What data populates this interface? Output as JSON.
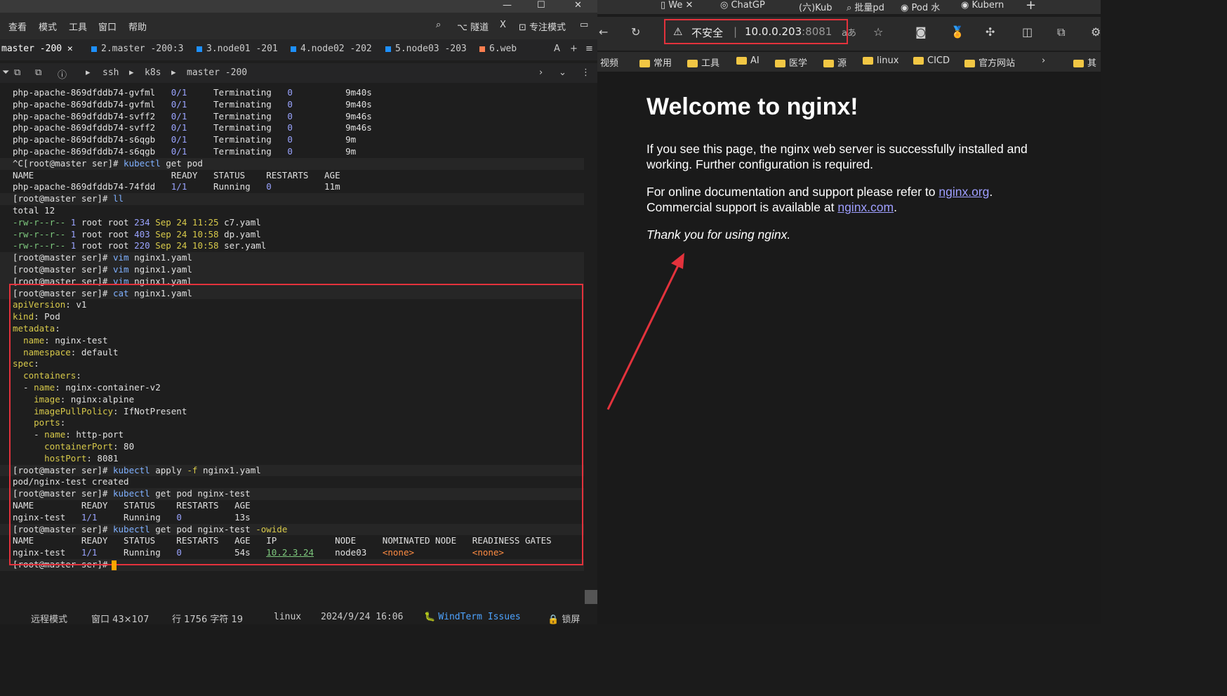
{
  "window": {
    "min": "—",
    "max": "☐",
    "close": "✕"
  },
  "menu": [
    "查看",
    "模式",
    "工具",
    "窗口",
    "帮助"
  ],
  "menu_right": {
    "search": "⌕",
    "tunnel": "隧道",
    "x": "X",
    "focus": "专注模式",
    "layout": "▭"
  },
  "tabs": [
    {
      "label": "master -200"
    },
    {
      "label": "2.master -200:3"
    },
    {
      "label": "3.node01 -201"
    },
    {
      "label": "4.node02 -202"
    },
    {
      "label": "5.node03 -203"
    },
    {
      "label": "6.web"
    }
  ],
  "tab_tools": [
    "A",
    "+",
    "≡"
  ],
  "crumb": [
    "ssh",
    "k8s",
    "master -200"
  ],
  "terminal": [
    [
      "php-apache-869dfddb74-gvfml   0/1     Terminating   0          9m40s"
    ],
    [
      "php-apache-869dfddb74-gvfml   0/1     Terminating   0          9m40s"
    ],
    [
      "php-apache-869dfddb74-svff2   0/1     Terminating   0          9m46s"
    ],
    [
      "php-apache-869dfddb74-svff2   0/1     Terminating   0          9m46s"
    ],
    [
      "php-apache-869dfddb74-s6qgb   0/1     Terminating   0          9m"
    ],
    [
      "php-apache-869dfddb74-s6qgb   0/1     Terminating   0          9m"
    ],
    [
      "^C[root@master ser]# kubectl get pod"
    ],
    [
      "NAME                          READY   STATUS    RESTARTS   AGE"
    ],
    [
      "php-apache-869dfddb74-74fdd   1/1     Running   0          11m"
    ],
    [
      "[root@master ser]# ll"
    ],
    [
      "total 12"
    ],
    [
      "-rw-r--r-- 1 root root 234 Sep 24 11:25 c7.yaml"
    ],
    [
      "-rw-r--r-- 1 root root 403 Sep 24 10:58 dp.yaml"
    ],
    [
      "-rw-r--r-- 1 root root 220 Sep 24 10:58 ser.yaml"
    ],
    [
      "[root@master ser]# vim nginx1.yaml"
    ],
    [
      "[root@master ser]# vim nginx1.yaml"
    ],
    [
      "[root@master ser]# vim nginx1.yaml"
    ],
    [
      "[root@master ser]# cat nginx1.yaml"
    ],
    [
      "apiVersion: v1"
    ],
    [
      "kind: Pod"
    ],
    [
      "metadata:"
    ],
    [
      "  name: nginx-test"
    ],
    [
      "  namespace: default"
    ],
    [
      "spec:"
    ],
    [
      "  containers:"
    ],
    [
      "  - name: nginx-container-v2"
    ],
    [
      "    image: nginx:alpine"
    ],
    [
      "    imagePullPolicy: IfNotPresent"
    ],
    [
      "    ports:"
    ],
    [
      "    - name: http-port"
    ],
    [
      "      containerPort: 80"
    ],
    [
      "      hostPort: 8081"
    ],
    [
      "[root@master ser]# kubectl apply -f nginx1.yaml"
    ],
    [
      "pod/nginx-test created"
    ],
    [
      "[root@master ser]# kubectl get pod nginx-test"
    ],
    [
      "NAME         READY   STATUS    RESTARTS   AGE"
    ],
    [
      "nginx-test   1/1     Running   0          13s"
    ],
    [
      "[root@master ser]# kubectl get pod nginx-test -owide"
    ],
    [
      "NAME         READY   STATUS    RESTARTS   AGE   IP           NODE     NOMINATED NODE   READINESS GATES"
    ],
    [
      "nginx-test   1/1     Running   0          54s   10.2.3.24    node03   <none>           <none>"
    ],
    [
      "[root@master ser]# "
    ]
  ],
  "status": {
    "mode": "远程模式",
    "window": "窗口 43×107",
    "pos": "行 1756 字符 19",
    "os": "linux",
    "datetime": "2024/9/24 16:06",
    "issues": "WindTerm Issues",
    "lock": "锁屏"
  },
  "browser": {
    "tabs": [
      "We",
      "ChatGP",
      "(六)Kub",
      "批量pd",
      "Pod 水",
      "Kubern"
    ],
    "new_tab": "+",
    "insecure": "不安全",
    "url_host": "10.0.0.203",
    "url_port": ":8081",
    "read_aloud": "aあ",
    "bookmarks": [
      "视频",
      "常用",
      "工具",
      "AI",
      "医学",
      "源",
      "linux",
      "CICD",
      "官方网站",
      "其"
    ],
    "more": "›"
  },
  "nginx": {
    "title": "Welcome to nginx!",
    "p1": "If you see this page, the nginx web server is successfully installed and working. Further configuration is required.",
    "p2a": "For online documentation and support please refer to ",
    "link1": "nginx.org",
    "p2b": ".",
    "p2c": "Commercial support is available at ",
    "link2": "nginx.com",
    "p2d": ".",
    "p3": "Thank you for using nginx."
  },
  "colors": {
    "accent_red": "#e3323c",
    "link": "#9e9eff",
    "prompt_cmd": "#7fb0ff"
  }
}
